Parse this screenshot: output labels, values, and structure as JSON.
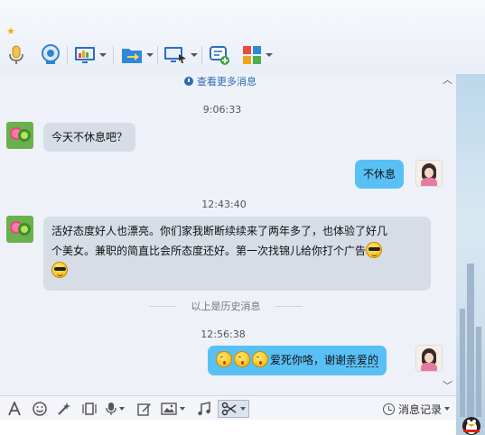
{
  "toolbar": {
    "items": [
      "voice-icon",
      "video-icon",
      "screen-share-icon",
      "file-transfer-icon",
      "remote-desktop-icon",
      "add-app-icon",
      "more-apps-icon"
    ]
  },
  "history": {
    "view_more": "查看更多消息",
    "divider": "以上是历史消息"
  },
  "messages": [
    {
      "time": "9:06:33",
      "side": "left",
      "text": "今天不休息吧？"
    },
    {
      "side": "right",
      "text": "不休息"
    },
    {
      "time": "12:43:40",
      "side": "left",
      "line1": "活好态度好人也漂亮。你们家我断断续续来了两年多了，也体验了好几",
      "line2": "个美女。兼职的简直比会所态度还好。第一次找锦儿给你打个广告"
    },
    {
      "time": "12:56:38",
      "side": "right",
      "text_a": "爱死你咯，谢谢",
      "text_b": "亲爱的"
    }
  ],
  "bottom": {
    "tools": [
      "font-icon",
      "emoji-icon",
      "magic-icon",
      "shake-icon",
      "voice-msg-icon",
      "edit-icon",
      "image-icon",
      "music-icon",
      "screenshot-icon"
    ],
    "log_label": "消息记录"
  }
}
